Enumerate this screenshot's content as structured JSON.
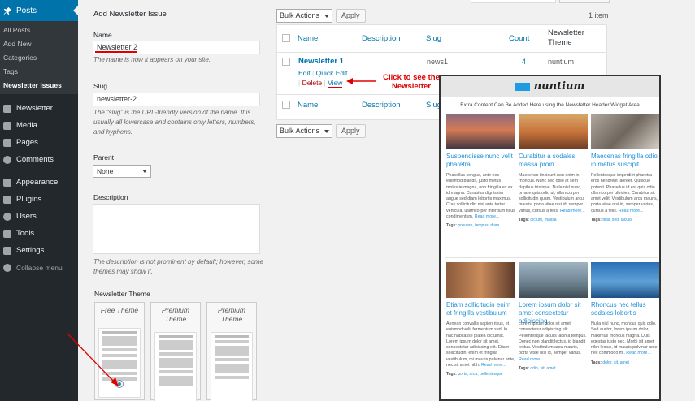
{
  "sidebar": {
    "posts_label": "Posts",
    "submenu": [
      "All Posts",
      "Add New",
      "Categories",
      "Tags",
      "Newsletter Issues"
    ],
    "menu": [
      {
        "label": "Newsletter",
        "icon": "newsletter-icon"
      },
      {
        "label": "Media",
        "icon": "media-icon"
      },
      {
        "label": "Pages",
        "icon": "pages-icon"
      },
      {
        "label": "Comments",
        "icon": "comments-icon"
      },
      {
        "label": "Appearance",
        "icon": "appearance-icon"
      },
      {
        "label": "Plugins",
        "icon": "plugins-icon"
      },
      {
        "label": "Users",
        "icon": "users-icon"
      },
      {
        "label": "Tools",
        "icon": "tools-icon"
      },
      {
        "label": "Settings",
        "icon": "settings-icon"
      }
    ],
    "collapse_label": "Collapse menu"
  },
  "form": {
    "heading": "Add Newsletter Issue",
    "name_label": "Name",
    "name_value": "Newsletter 2",
    "name_desc": "The name is how it appears on your site.",
    "slug_label": "Slug",
    "slug_value": "newsletter-2",
    "slug_desc": "The “slug” is the URL-friendly version of the name. It is usually all lowercase and contains only letters, numbers, and hyphens.",
    "parent_label": "Parent",
    "parent_value": "None",
    "description_label": "Description",
    "description_desc": "The description is not prominent by default; however, some themes may show it.",
    "theme_label": "Newsletter Theme",
    "themes": [
      "Free Theme",
      "Premium Theme",
      "Premium Theme"
    ]
  },
  "table": {
    "bulk_actions": "Bulk Actions",
    "apply": "Apply",
    "count_text": "1 item",
    "headers": {
      "name": "Name",
      "description": "Description",
      "slug": "Slug",
      "count": "Count",
      "theme": "Newsletter Theme"
    },
    "row": {
      "name": "Newsletter 1",
      "slug": "news1",
      "count": "4",
      "theme": "nuntium",
      "actions": {
        "edit": "Edit",
        "quick_edit": "Quick Edit",
        "delete": "Delete",
        "view": "View"
      }
    }
  },
  "annotation": "Click to see the Newsletter",
  "preview": {
    "logo": "nuntium",
    "extra": "Extra Content Can Be Added Here using the Newsletter Header Widget Area",
    "cards": [
      {
        "title": "Suspendisse nunc velit pharetra",
        "body": "Phasellus congue, ante nec euismod blandit, justo metus molestie magna, non fringilla ex ex id magna. Curabitur dignissim augue sed diam lobortis maximus. Cras sollicitudin nisl ante tortor vehicula, ullamcorper interdum risus condimentum.",
        "more": "Read more...",
        "tags_label": "Tags:",
        "tags": "posuere, tempus, diam"
      },
      {
        "title": "Curabitur a sodales massa proin",
        "body": "Maecenas tincidunt non enim in rhoncus. Nunc sed odio at sem dapibus tristique. Nulla nisl nunc, ornare quis odio ut, ullamcorper sollicitudin quam. Vestibulum arcu mauris, porta vitae nisi id, semper varius, cursus a felis.",
        "more": "Read more...",
        "tags_label": "Tags:",
        "tags": "dictum, massa"
      },
      {
        "title": "Maecenas fringilla odio in metus suscipit",
        "body": "Pellentesque imperdiet pharetra eros hendrerit laoreet. Quisque potenti. Phasellus id est quis odio ullamcorper ultricies. Curabitur sit amet velit. Vestibulum arcu mauris, porta vitae nisi id, semper varius, cursus a felis.",
        "more": "Read more...",
        "tags_label": "Tags:",
        "tags": "felis, sed, iaculis"
      },
      {
        "title": "Etiam sollicitudin enim et fringilla vestibulum",
        "body": "Aenean convallis sapien risus, et euismod velit fermentum sed. In hac habitasse platea dictumst. Lorem ipsum dolor sit amet, consectetur adipiscing elit. Etiam sollicitudin, enim et fringilla vestibulum, mi mauris pulvinar ante, nec sit amet nibh.",
        "more": "Read more...",
        "tags_label": "Tags:",
        "tags": "porta, arcu, pellentesque"
      },
      {
        "title": "Lorem ipsum dolor sit amet consectetur adipiscing",
        "body": "Lorem ipsum dolor sit amet, consectetur adipiscing elit. Pellentesque iaculis lacinia tempus. Donec non blandit lectus, id blandit lectus. Vestibulum arcu mauris, porta vitae nisi id, semper varius.",
        "more": "Read more...",
        "tags_label": "Tags:",
        "tags": "odio, sit, amet"
      },
      {
        "title": "Rhoncus nec tellus sodales lobortis",
        "body": "Nulla nisl nunc, rhoncus quis odio. Sed auctor, lorem ipsum dolor, maximus rhoncus magna. Duis egestas justo nec. Morbi sit amet nibh lectus, id mauris pulvinar ante, nec commodo mi.",
        "more": "Read more...",
        "tags_label": "Tags:",
        "tags": "dolor, sit, amet"
      }
    ]
  },
  "colors": {
    "accent": "#0073aa",
    "annotation": "#e00000",
    "sidebar": "#23282d"
  }
}
